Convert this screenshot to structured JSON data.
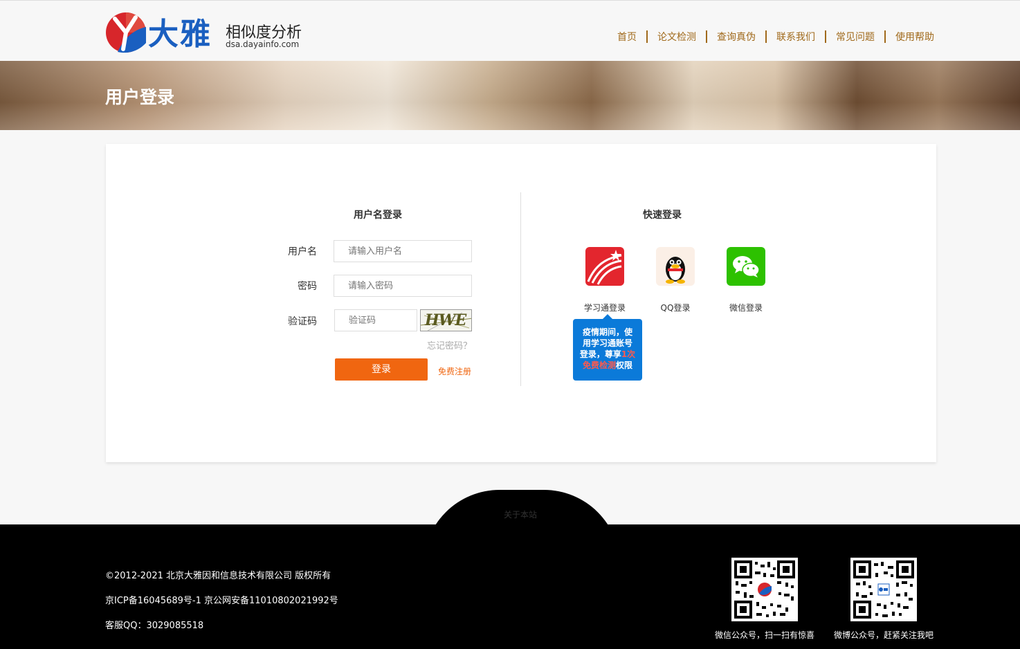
{
  "header": {
    "logo": {
      "brand": "大雅",
      "subtitle": "相似度分析",
      "url": "dsa.dayainfo.com"
    },
    "nav": [
      "首页",
      "论文检测",
      "查询真伪",
      "联系我们",
      "常见问题",
      "使用帮助"
    ],
    "nav_color": "#a0691a"
  },
  "banner": {
    "title": "用户登录"
  },
  "login": {
    "title": "用户名登录",
    "username_label": "用户名",
    "username_placeholder": "请输入用户名",
    "password_label": "密码",
    "password_placeholder": "请输入密码",
    "captcha_label": "验证码",
    "captcha_placeholder": "验证码",
    "captcha_text": "HWE",
    "forgot": "忘记密码？",
    "submit": "登录",
    "register": "免费注册",
    "accent": "#f06610"
  },
  "quick_login": {
    "title": "快速登录",
    "options": [
      {
        "label": "学习通登录",
        "icon": "xuexitong-icon"
      },
      {
        "label": "QQ登录",
        "icon": "qq-penguin-icon"
      },
      {
        "label": "微信登录",
        "icon": "wechat-icon"
      }
    ],
    "tip": {
      "text_before": "疫情期间，使用学习通账号登录，尊享",
      "highlight_1": "1次",
      "highlight_2": "免费检测",
      "text_after": "权限"
    }
  },
  "footer": {
    "about": "关于本站",
    "copyright": "©2012-2021 北京大雅因和信息技术有限公司 版权所有",
    "icp": "京ICP备16045689号-1  京公网安备11010802021992号",
    "service_qq": "客服QQ：3029085518",
    "qr_codes": [
      {
        "label": "微信公众号，扫一扫有惊喜"
      },
      {
        "label": "微博公众号，赶紧关注我吧"
      }
    ]
  }
}
